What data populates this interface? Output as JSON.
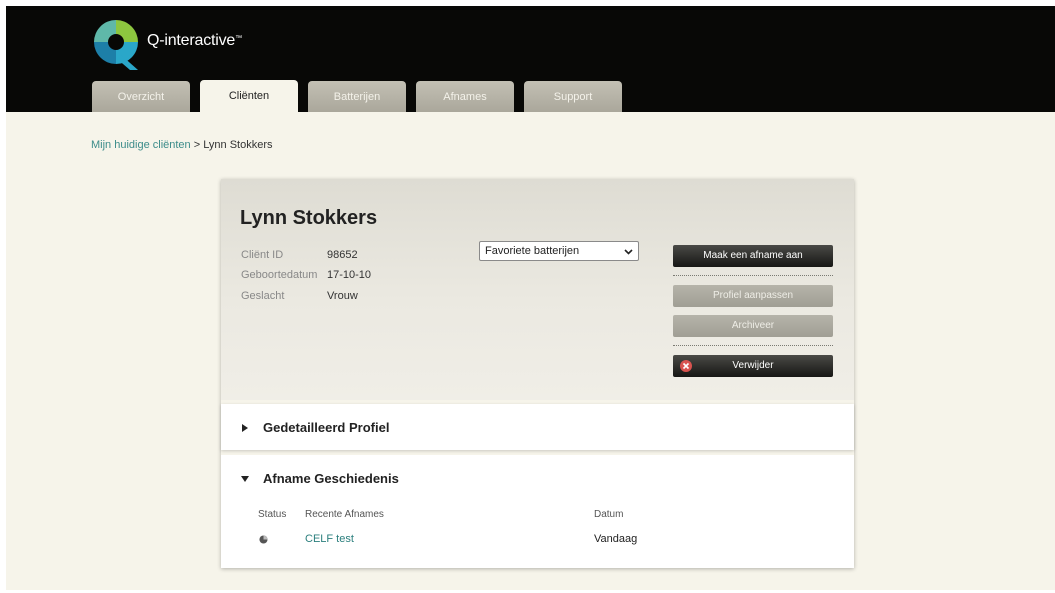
{
  "brand": {
    "name": "Q-interactive",
    "trademark": "™"
  },
  "nav": {
    "tabs": [
      {
        "label": "Overzicht",
        "active": false
      },
      {
        "label": "Cliënten",
        "active": true
      },
      {
        "label": "Batterijen",
        "active": false
      },
      {
        "label": "Afnames",
        "active": false
      },
      {
        "label": "Support",
        "active": false
      }
    ]
  },
  "breadcrumb": {
    "link": "Mijn huidige cliënten",
    "separator": " > ",
    "current": "Lynn Stokkers"
  },
  "client": {
    "name": "Lynn Stokkers",
    "fields": [
      {
        "label": "Cliënt ID",
        "value": "98652"
      },
      {
        "label": "Geboortedatum",
        "value": "17-10-10"
      },
      {
        "label": "Geslacht",
        "value": "Vrouw"
      }
    ]
  },
  "battery_select": {
    "selected": "Favoriete batterijen"
  },
  "actions": {
    "create_label": "Maak een afname aan",
    "edit_label": "Profiel aanpassen",
    "archive_label": "Archiveer",
    "delete_label": "Verwijder"
  },
  "sections": {
    "profile_title": "Gedetailleerd Profiel",
    "history_title": "Afname Geschiedenis"
  },
  "history": {
    "columns": {
      "status": "Status",
      "recent": "Recente Afnames",
      "date": "Datum"
    },
    "rows": [
      {
        "name": "CELF test",
        "date": "Vandaag"
      }
    ]
  },
  "colors": {
    "accent": "#3c8c8a",
    "link": "#2b7f7d",
    "delete": "#d9534f",
    "topbar": "#080806"
  }
}
